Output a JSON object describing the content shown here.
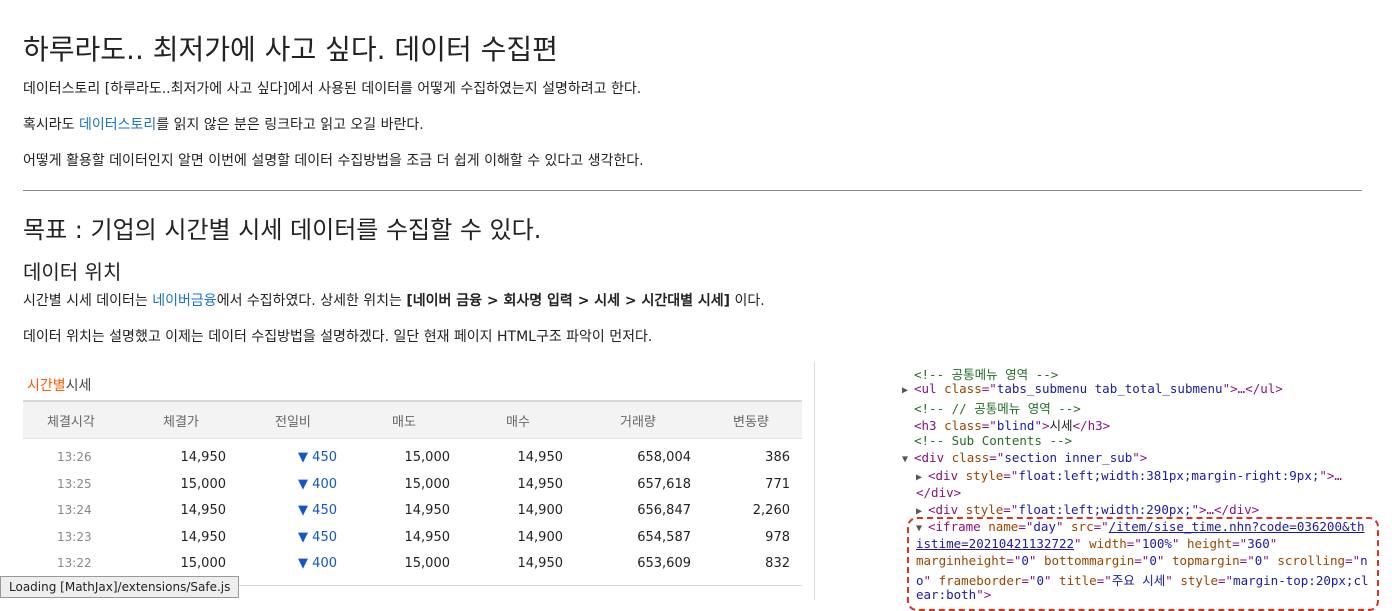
{
  "article": {
    "title": "하루라도.. 최저가에 사고 싶다. 데이터 수집편",
    "p1": "데이터스토리 [하루라도..최저가에 사고 싶다]에서 사용된 데이터를 어떻게 수집하였는지 설명하려고 한다.",
    "p2_pre": "혹시라도 ",
    "p2_link": "데이터스토리",
    "p2_post": "를 읽지 않은 분은 링크타고 읽고 오길 바란다.",
    "p3": "어떻게 활용할 데이터인지 알면 이번에 설명할 데이터 수집방법을 조금 더 쉽게 이해할 수 있다고 생각한다.",
    "goal": "목표 : 기업의 시간별 시세 데이터를 수집할 수 있다.",
    "subheading": "데이터 위치",
    "p4_pre": "시간별 시세 데이터는 ",
    "p4_link": "네이버금융",
    "p4_mid": "에서 수집하였다. 상세한 위치는 ",
    "p4_bold": "[네이버 금융 > 회사명 입력 > 시세 > 시간대별 시세]",
    "p4_post": " 이다.",
    "p5": "데이터 위치는 설명했고 이제는 데이터 수집방법을 설명하겠다. 일단 현재 페이지 HTML구조 파악이 먼저다."
  },
  "stock": {
    "title_highlight": "시간별",
    "title_rest": "시세",
    "columns": [
      "체결시각",
      "체결가",
      "전일비",
      "매도",
      "매수",
      "거래량",
      "변동량"
    ],
    "rows": [
      {
        "time": "13:26",
        "price": "14,950",
        "diff": "▼  450",
        "ask": "15,000",
        "bid": "14,950",
        "volume": "658,004",
        "change": "386"
      },
      {
        "time": "13:25",
        "price": "15,000",
        "diff": "▼  400",
        "ask": "15,000",
        "bid": "14,950",
        "volume": "657,618",
        "change": "771"
      },
      {
        "time": "13:24",
        "price": "14,950",
        "diff": "▼  450",
        "ask": "14,950",
        "bid": "14,900",
        "volume": "656,847",
        "change": "2,260"
      },
      {
        "time": "13:23",
        "price": "14,950",
        "diff": "▼  450",
        "ask": "14,950",
        "bid": "14,900",
        "volume": "654,587",
        "change": "978"
      },
      {
        "time": "13:22",
        "price": "15,000",
        "diff": "▼  400",
        "ask": "15,000",
        "bid": "14,950",
        "volume": "653,609",
        "change": "832"
      }
    ],
    "down_color": "#1456c9",
    "highlight_color": "#ff5a00"
  },
  "devtools": {
    "l1_comment": "<!-- 공통메뉴 영역 -->",
    "l2_open": "<ul ",
    "l2_attr": "class",
    "l2_eq": "=\"",
    "l2_val": "tabs_submenu tab_total_submenu",
    "l2_close": "\">…</ul>",
    "l3_comment": "<!-- // 공통메뉴 영역 -->",
    "l4_open": "<h3 ",
    "l4_attr": "class",
    "l4_eq": "=\"",
    "l4_val": "blind",
    "l4_mid": "\">",
    "l4_text": "시세",
    "l4_close": "</h3>",
    "l5_comment": "<!-- Sub Contents -->",
    "l6_open": "<div ",
    "l6_attr": "class",
    "l6_eq": "=\"",
    "l6_val": "section inner_sub",
    "l6_close": "\">",
    "l7_open": "<div ",
    "l7_attr": "style",
    "l7_eq": "=\"",
    "l7_val": "float:left;width:381px;margin-right:9px;",
    "l7_close": "\">…",
    "l8_close": "</div>",
    "l9_open": "<div ",
    "l9_attr": "style",
    "l9_eq": "=\"",
    "l9_val": "float:left;width:290px;",
    "l9_close": "\">…</div>",
    "l10_open": "<iframe ",
    "l10_a1": "name",
    "l10_v1": "day",
    "l10_a2": "src",
    "l10_v2": "/item/sise_time.nhn?code=036200&th",
    "l11_v2b": "istime=20210421132722",
    "l11_a3": "width",
    "l11_v3": "100%",
    "l11_a4": "height",
    "l11_v4": "360",
    "l12_a5": "marginheight",
    "l12_v5": "0",
    "l12_a6": "bottommargin",
    "l12_v6": "0",
    "l12_a7": "topmargin",
    "l12_v7": "0",
    "l12_a8": "scrolling",
    "l12_v8a": "n",
    "l13_v8b": "o",
    "l13_a9": "frameborder",
    "l13_v9": "0",
    "l13_a10": "title",
    "l13_v10": "주요 시세",
    "l13_a11": "style",
    "l13_v11a": "margin-top:20px;cl",
    "l14_v11b": "ear:both",
    "l14_close": "\">"
  },
  "status_bar": "Loading [MathJax]/extensions/Safe.js"
}
